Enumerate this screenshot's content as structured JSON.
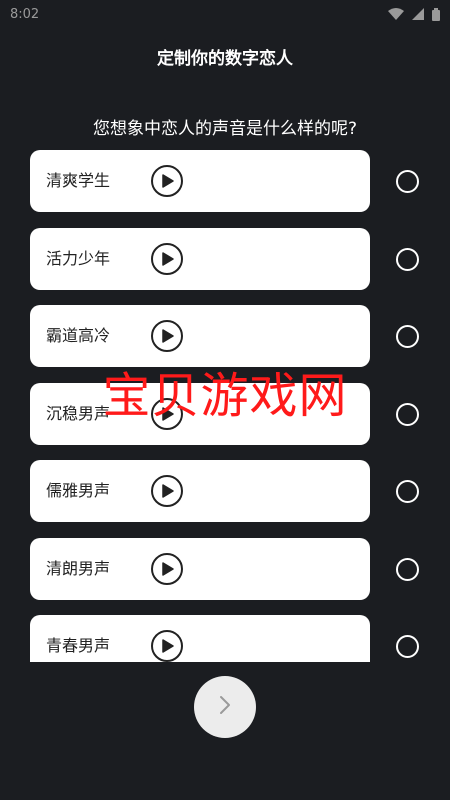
{
  "status_bar": {
    "time": "8:02",
    "icons": [
      "wifi-icon",
      "signal-icon",
      "battery-icon"
    ]
  },
  "header": {
    "title": "定制你的数字恋人"
  },
  "question": "您想象中恋人的声音是什么样的呢?",
  "voices": [
    {
      "label": "清爽学生"
    },
    {
      "label": "活力少年"
    },
    {
      "label": "霸道高冷"
    },
    {
      "label": "沉稳男声"
    },
    {
      "label": "儒雅男声"
    },
    {
      "label": "清朗男声"
    },
    {
      "label": "青春男声"
    }
  ],
  "watermark": "宝贝游戏网",
  "next_button": {
    "icon": "chevron-right-icon"
  },
  "colors": {
    "background": "#1b1d21",
    "card": "#ffffff",
    "watermark": "#ff1a1a",
    "next_button": "#ececec"
  }
}
